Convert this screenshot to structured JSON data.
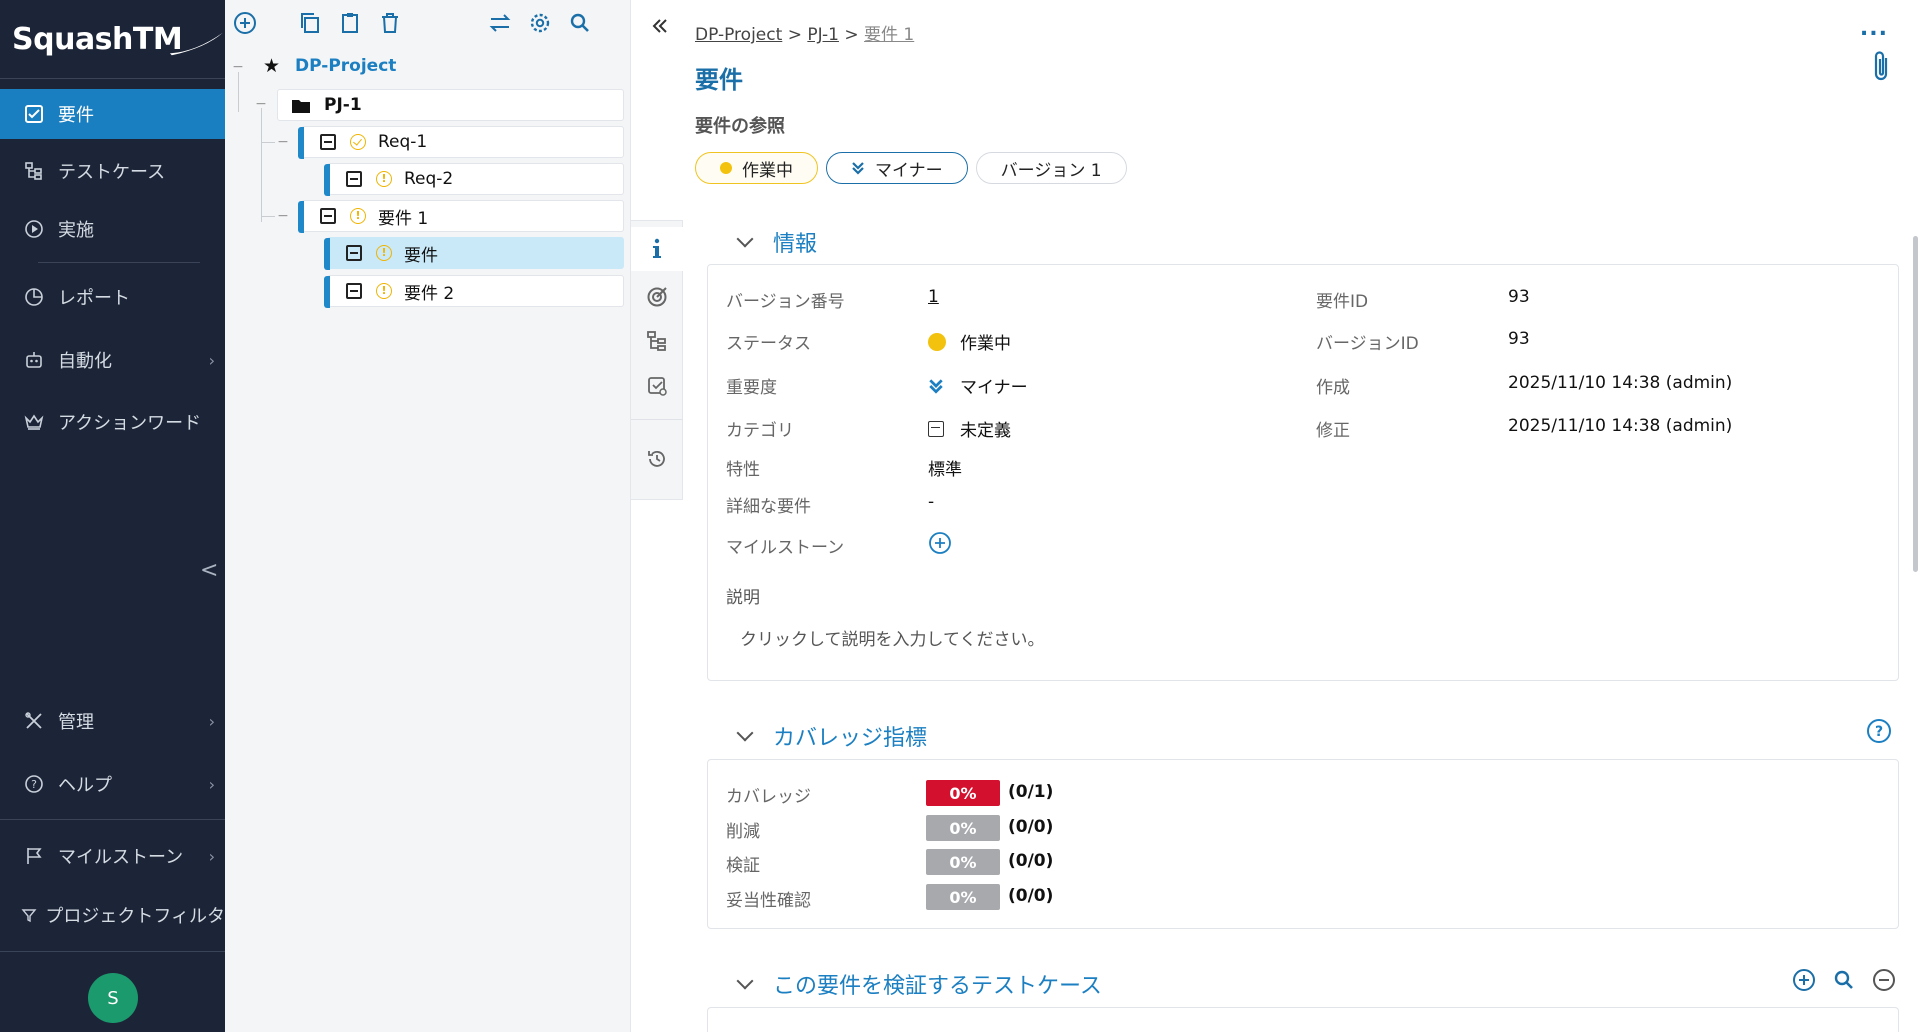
{
  "app": {
    "logo_text": "SquashTM"
  },
  "nav": {
    "items": [
      {
        "label": "要件",
        "icon": "requirements-icon"
      },
      {
        "label": "テストケース",
        "icon": "test-case-tree-icon"
      },
      {
        "label": "実施",
        "icon": "execution-play-icon"
      },
      {
        "label": "レポート",
        "icon": "report-pie-icon"
      },
      {
        "label": "自動化",
        "icon": "robot-icon"
      },
      {
        "label": "アクションワード",
        "icon": "crown-icon"
      },
      {
        "label": "管理",
        "icon": "tools-icon"
      },
      {
        "label": "ヘルプ",
        "icon": "help-icon"
      },
      {
        "label": "マイルストーン",
        "icon": "flag-icon"
      },
      {
        "label": "プロジェクトフィルタ",
        "icon": "filter-icon"
      }
    ],
    "collapse_glyph": "<",
    "chevron": "›",
    "avatar_initial": "S"
  },
  "tree": {
    "project": "DP-Project",
    "nodes": [
      {
        "label": "PJ-1",
        "type": "folder"
      },
      {
        "label": "Req-1",
        "type": "requirement",
        "status": "ok"
      },
      {
        "label": "Req-2",
        "type": "requirement",
        "status": "warn"
      },
      {
        "label": "要件 1",
        "type": "requirement",
        "status": "warn"
      },
      {
        "label": "要件",
        "type": "requirement",
        "status": "warn",
        "selected": true
      },
      {
        "label": "要件 2",
        "type": "requirement",
        "status": "warn"
      }
    ]
  },
  "breadcrumb": {
    "items": [
      "DP-Project",
      "PJ-1",
      "要件 1"
    ],
    "sep": ">"
  },
  "header": {
    "title": "要件",
    "ref_label": "要件の参照",
    "status_pill": "作業中",
    "criticality_pill": "マイナー",
    "version_pill": "バージョン 1",
    "more": "..."
  },
  "info": {
    "title": "情報",
    "labels": {
      "version_no": "バージョン番号",
      "status": "ステータス",
      "criticality": "重要度",
      "category": "カテゴリ",
      "nature": "特性",
      "detailed": "詳細な要件",
      "milestones": "マイルストーン",
      "req_id": "要件ID",
      "version_id": "バージョンID",
      "created": "作成",
      "modified": "修正",
      "description": "説明"
    },
    "values": {
      "version_no": "1",
      "status": "作業中",
      "criticality": "マイナー",
      "category": "未定義",
      "nature": "標準",
      "detailed": "-",
      "req_id": "93",
      "version_id": "93",
      "created": "2025/11/10 14:38 (admin)",
      "modified": "2025/11/10 14:38 (admin)",
      "description_placeholder": "クリックして説明を入力してください。"
    }
  },
  "coverage": {
    "title": "カバレッジ指標",
    "rows": [
      {
        "label": "カバレッジ",
        "pct": "0%",
        "ratio": "(0/1)",
        "color": "#d3112e"
      },
      {
        "label": "削減",
        "pct": "0%",
        "ratio": "(0/0)",
        "color": "#a7a9ad"
      },
      {
        "label": "検証",
        "pct": "0%",
        "ratio": "(0/0)",
        "color": "#a7a9ad"
      },
      {
        "label": "妥当性確認",
        "pct": "0%",
        "ratio": "(0/0)",
        "color": "#a7a9ad"
      }
    ]
  },
  "testcases": {
    "title": "この要件を検証するテストケース"
  },
  "colors": {
    "accent": "#1a7fc1",
    "nav_bg": "#1c2537",
    "status_yellow": "#f2c20f",
    "danger": "#d3112e"
  }
}
